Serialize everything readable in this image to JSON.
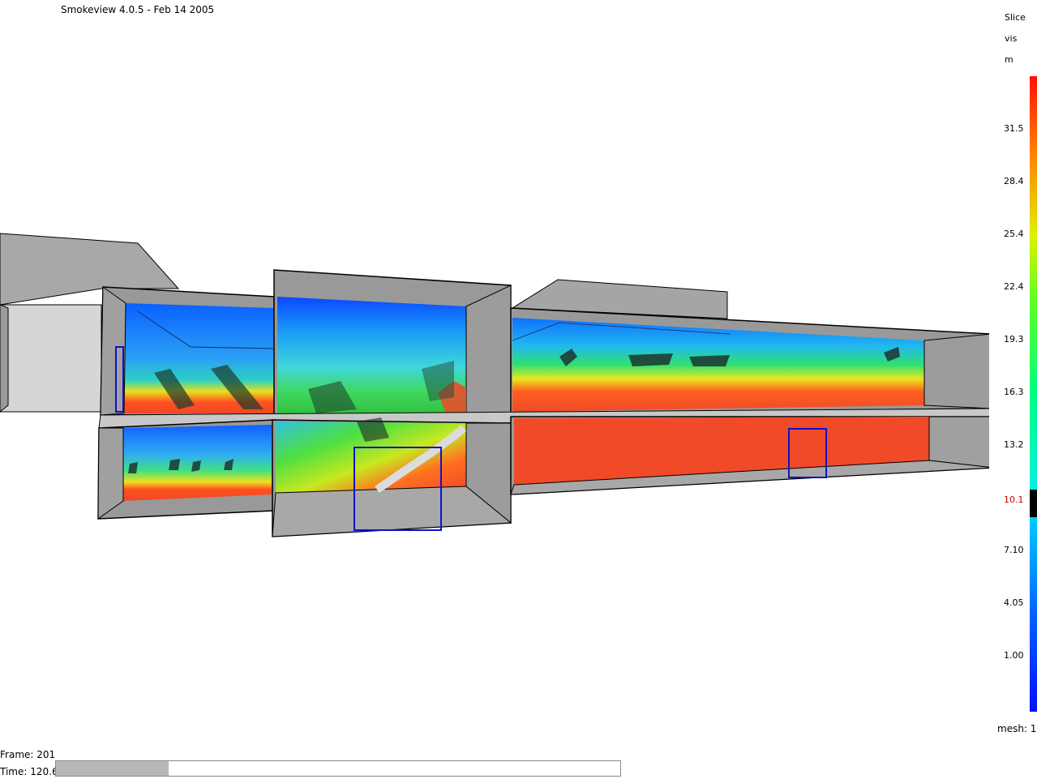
{
  "window": {
    "title": "Smokeview 4.0.5 - Feb 14 2005"
  },
  "legend": {
    "header": [
      "Slice",
      "vis",
      "m"
    ],
    "ticks": [
      "31.5",
      "28.4",
      "25.4",
      "22.4",
      "19.3",
      "16.3",
      "13.2",
      "10.1",
      "7.10",
      "4.05",
      "1.00"
    ],
    "highlighted_tick": "10.1",
    "mesh_label": "mesh: 1"
  },
  "status": {
    "frame_label": "Frame: 201",
    "time_label": "Time: 120.6",
    "time_progress": 0.2
  },
  "colors": {
    "highlight_tick": "#cc0000",
    "box_gray": "#9a9a9a",
    "outline": "#000000",
    "vent_blue": "#1010cc"
  }
}
